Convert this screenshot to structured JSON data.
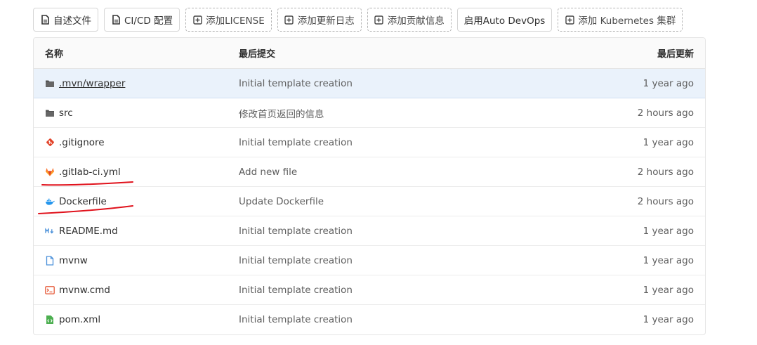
{
  "toolbar": {
    "buttons": [
      {
        "label": "自述文件",
        "icon": "document-icon",
        "style": "solid"
      },
      {
        "label": "CI/CD 配置",
        "icon": "document-icon",
        "style": "solid"
      },
      {
        "label": "添加LICENSE",
        "icon": "plus-square-icon",
        "style": "dashed"
      },
      {
        "label": "添加更新日志",
        "icon": "plus-square-icon",
        "style": "dashed"
      },
      {
        "label": "添加贡献信息",
        "icon": "plus-square-icon",
        "style": "dashed"
      },
      {
        "label": "启用Auto DevOps",
        "icon": null,
        "style": "solid"
      },
      {
        "label": "添加 Kubernetes 集群",
        "icon": "plus-square-icon",
        "style": "dashed"
      }
    ]
  },
  "table": {
    "headers": {
      "name": "名称",
      "commit": "最后提交",
      "updated": "最后更新"
    },
    "rows": [
      {
        "name": ".mvn/wrapper",
        "icon": "folder-icon",
        "commit": "Initial template creation",
        "updated": "1 year ago"
      },
      {
        "name": "src",
        "icon": "folder-icon",
        "commit": "修改首页返回的信息",
        "updated": "2 hours ago"
      },
      {
        "name": ".gitignore",
        "icon": "git-icon",
        "commit": "Initial template creation",
        "updated": "1 year ago"
      },
      {
        "name": ".gitlab-ci.yml",
        "icon": "gitlab-icon",
        "commit": "Add new file",
        "updated": "2 hours ago"
      },
      {
        "name": "Dockerfile",
        "icon": "docker-icon",
        "commit": "Update Dockerfile",
        "updated": "2 hours ago"
      },
      {
        "name": "README.md",
        "icon": "markdown-icon",
        "commit": "Initial template creation",
        "updated": "1 year ago"
      },
      {
        "name": "mvnw",
        "icon": "file-icon",
        "commit": "Initial template creation",
        "updated": "1 year ago"
      },
      {
        "name": "mvnw.cmd",
        "icon": "terminal-icon",
        "commit": "Initial template creation",
        "updated": "1 year ago"
      },
      {
        "name": "pom.xml",
        "icon": "xml-file-icon",
        "commit": "Initial template creation",
        "updated": "1 year ago"
      }
    ]
  },
  "colors": {
    "highlight_row": "#eaf2fb",
    "annotation_stroke": "#e0121c",
    "git_icon": "#e24329",
    "gitlab_icon": "#fc6d26",
    "docker_icon": "#2496ed",
    "markdown_icon": "#4a90d9",
    "terminal_icon": "#e65b3a",
    "xml_icon": "#4caf50"
  }
}
